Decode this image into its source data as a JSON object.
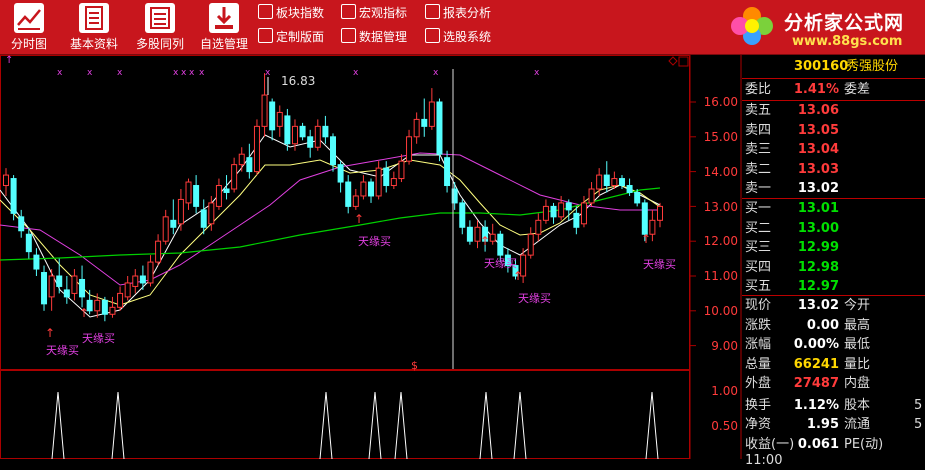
{
  "toolbar": {
    "buttons": [
      {
        "label": "分时图",
        "icon": "line-chart-icon"
      },
      {
        "label": "基本资料",
        "icon": "document-icon"
      },
      {
        "label": "多股同列",
        "icon": "list-icon"
      },
      {
        "label": "自选管理",
        "icon": "download-icon"
      }
    ],
    "small_buttons": [
      {
        "label": "板块指数",
        "icon": "grid-icon"
      },
      {
        "label": "宏观指标",
        "icon": "bar-chart-icon"
      },
      {
        "label": "报表分析",
        "icon": "table-icon"
      },
      {
        "label": "定制版面",
        "icon": "plus-icon"
      },
      {
        "label": "数据管理",
        "icon": "refresh-icon"
      },
      {
        "label": "选股系统",
        "icon": "select-icon"
      }
    ],
    "logo_text": "分析家公式网",
    "logo_url": "www.88gs.com"
  },
  "chart": {
    "high_label": "16.83",
    "signal_label": "天缘买",
    "marker_label": "$",
    "y_ticks": [
      "16.00",
      "15.00",
      "14.00",
      "13.00",
      "12.00",
      "11.00",
      "10.00",
      "9.00"
    ],
    "sub_y_ticks": [
      "1.00",
      "0.50"
    ]
  },
  "quote": {
    "code": "300160",
    "name": "秀强股份",
    "weibi_label": "委比",
    "weibi_value": "1.41%",
    "weicha_label": "委差",
    "asks": [
      {
        "label": "卖五",
        "price": "13.06"
      },
      {
        "label": "卖四",
        "price": "13.05"
      },
      {
        "label": "卖三",
        "price": "13.04"
      },
      {
        "label": "卖二",
        "price": "13.03"
      },
      {
        "label": "卖一",
        "price": "13.02"
      }
    ],
    "bids": [
      {
        "label": "买一",
        "price": "13.01"
      },
      {
        "label": "买二",
        "price": "13.00"
      },
      {
        "label": "买三",
        "price": "12.99"
      },
      {
        "label": "买四",
        "price": "12.98"
      },
      {
        "label": "买五",
        "price": "12.97"
      }
    ],
    "stats": [
      {
        "k": "现价",
        "v": "13.02",
        "c": "wht",
        "k2": "今开",
        "v2": ""
      },
      {
        "k": "涨跌",
        "v": "0.00",
        "c": "wht",
        "k2": "最高",
        "v2": ""
      },
      {
        "k": "涨幅",
        "v": "0.00%",
        "c": "wht",
        "k2": "最低",
        "v2": ""
      },
      {
        "k": "总量",
        "v": "66241",
        "c": "yel",
        "k2": "量比",
        "v2": ""
      },
      {
        "k": "外盘",
        "v": "27487",
        "c": "red",
        "k2": "内盘",
        "v2": ""
      },
      {
        "k": "换手",
        "v": "1.12%",
        "c": "wht",
        "k2": "股本",
        "v2": "5"
      },
      {
        "k": "净资",
        "v": "1.95",
        "c": "wht",
        "k2": "流通",
        "v2": "5"
      },
      {
        "k": "收益(一)",
        "v": "0.061",
        "c": "wht",
        "k2": "PE(动)",
        "v2": ""
      }
    ],
    "bottom_partial": "11:00"
  }
}
